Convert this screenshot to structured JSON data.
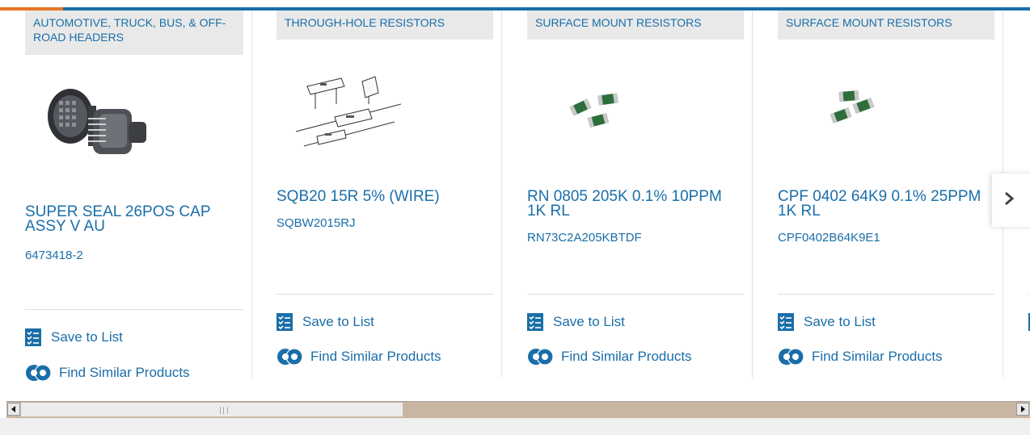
{
  "accent_colors": {
    "brand_blue": "#1a6ea8",
    "accent_orange": "#e87722"
  },
  "cards": [
    {
      "category": "AUTOMOTIVE, TRUCK, BUS, & OFF-ROAD HEADERS",
      "name": "SUPER SEAL 26POS CAP ASSY V AU",
      "part_number": "6473418-2",
      "image_icon": "connector-header-image",
      "save_label": "Save to List",
      "similar_label": "Find Similar Products"
    },
    {
      "category": "THROUGH-HOLE RESISTORS",
      "name": "SQB20 15R 5% (WIRE)",
      "part_number": "SQBW2015RJ",
      "image_icon": "through-hole-resistor-image",
      "save_label": "Save to List",
      "similar_label": "Find Similar Products"
    },
    {
      "category": "SURFACE MOUNT RESISTORS",
      "name": "RN 0805 205K 0.1% 10PPM 1K RL",
      "part_number": "RN73C2A205KBTDF",
      "image_icon": "smd-resistor-image",
      "save_label": "Save to List",
      "similar_label": "Find Similar Products"
    },
    {
      "category": "SURFACE MOUNT RESISTORS",
      "name": "CPF 0402 64K9 0.1% 25PPM 1K RL",
      "part_number": "CPF0402B64K9E1",
      "image_icon": "smd-resistor-image",
      "save_label": "Save to List",
      "similar_label": "Find Similar Products"
    }
  ],
  "carousel": {
    "next_icon": "chevron-right-icon"
  },
  "scrollbar": {
    "left_icon": "arrow-left-icon",
    "right_icon": "arrow-right-icon"
  }
}
